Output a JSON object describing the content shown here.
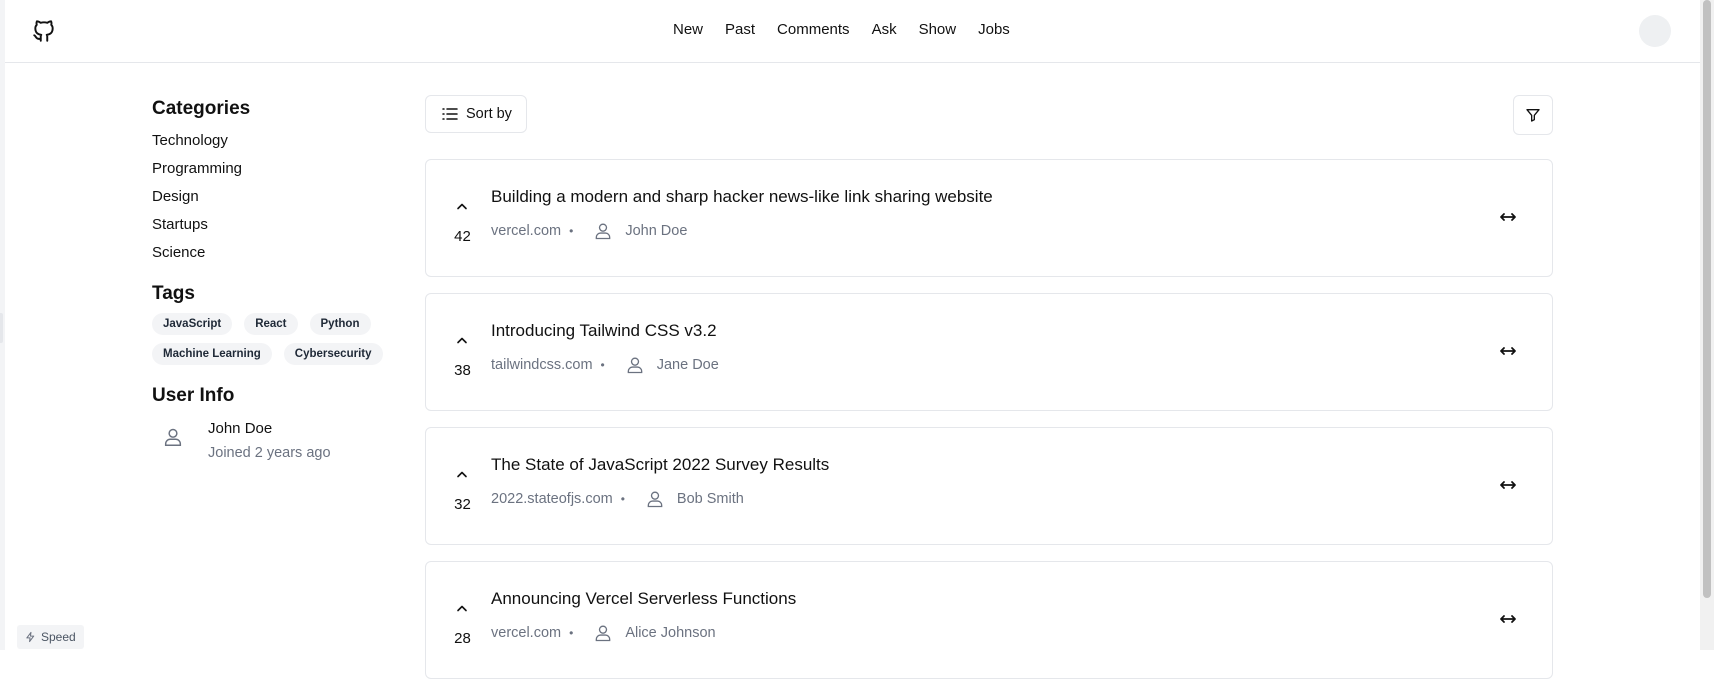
{
  "header": {
    "nav": [
      "New",
      "Past",
      "Comments",
      "Ask",
      "Show",
      "Jobs"
    ]
  },
  "sidebar": {
    "categories_title": "Categories",
    "categories": [
      "Technology",
      "Programming",
      "Design",
      "Startups",
      "Science"
    ],
    "tags_title": "Tags",
    "tags": [
      "JavaScript",
      "React",
      "Python",
      "Machine Learning",
      "Cybersecurity"
    ],
    "userinfo_title": "User Info",
    "user": {
      "name": "John Doe",
      "joined": "Joined 2 years ago"
    }
  },
  "toolbar": {
    "sort_label": "Sort by"
  },
  "posts": [
    {
      "score": "42",
      "title": "Building a modern and sharp hacker news-like link sharing website",
      "domain": "vercel.com",
      "author": "John Doe"
    },
    {
      "score": "38",
      "title": "Introducing Tailwind CSS v3.2",
      "domain": "tailwindcss.com",
      "author": "Jane Doe"
    },
    {
      "score": "32",
      "title": "The State of JavaScript 2022 Survey Results",
      "domain": "2022.stateofjs.com",
      "author": "Bob Smith"
    },
    {
      "score": "28",
      "title": "Announcing Vercel Serverless Functions",
      "domain": "vercel.com",
      "author": "Alice Johnson"
    }
  ],
  "badge": {
    "label": "Speed"
  },
  "icons": {
    "logo": "github-icon",
    "sort": "list-icon",
    "filter": "filter-icon",
    "upvote": "chevron-up-icon",
    "user": "user-icon",
    "expand": "arrows-horizontal-icon",
    "speed": "lightning-icon"
  }
}
